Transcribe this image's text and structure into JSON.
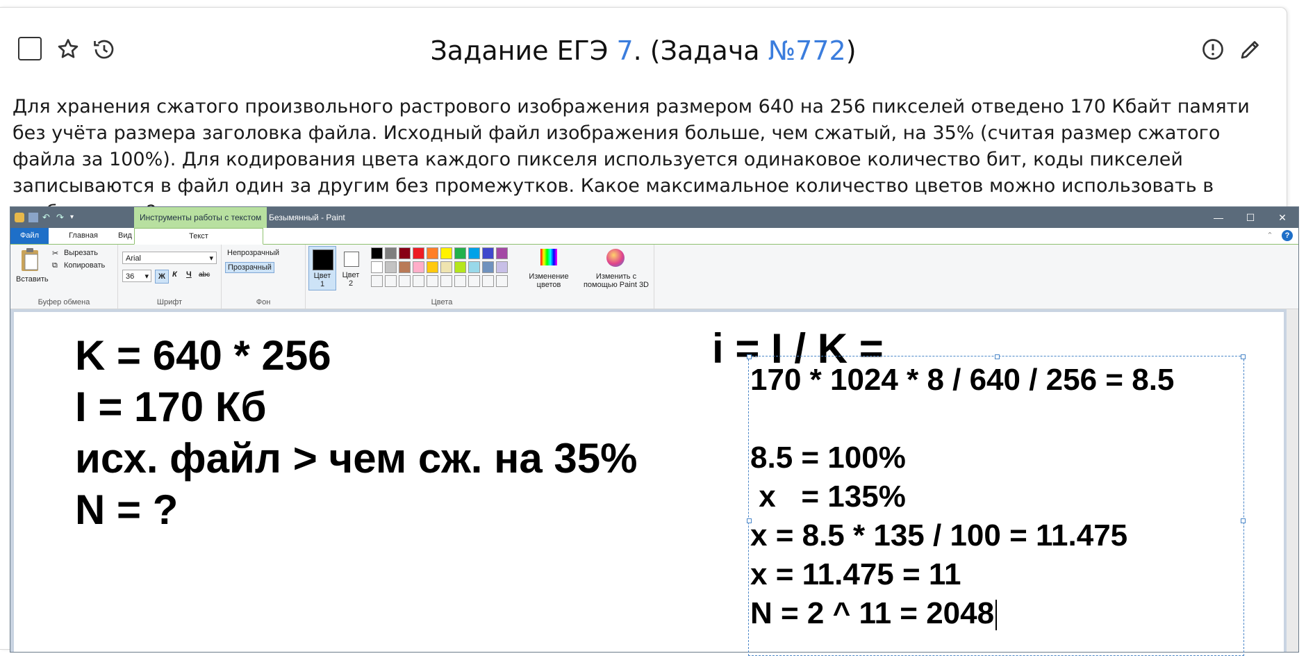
{
  "header": {
    "title_prefix": "Задание ЕГЭ ",
    "title_num": "7",
    "title_mid": ". (Задача ",
    "title_link": "№772",
    "title_suffix": ")"
  },
  "task_text": "Для хранения сжатого произвольного растрового изображения размером 640 на 256 пикселей отведено 170 Кбайт памяти без учёта размера заголовка файла. Исходный файл изображения больше, чем сжатый, на 35% (считая размер сжатого файла за 100%). Для кодирования цвета каждого пикселя используется одинаковое количество бит, коды пикселей записываются в файл один за другим без промежутков. Какое максимальное количество цветов можно использовать в изображении?",
  "paint": {
    "context_tab": "Инструменты работы с текстом",
    "window_title": "Безымянный - Paint",
    "tabs": [
      "Файл",
      "Главная",
      "Вид",
      "Текст"
    ],
    "clipboard": {
      "paste": "Вставить",
      "cut": "Вырезать",
      "copy": "Копировать",
      "label": "Буфер обмена"
    },
    "font": {
      "name": "Arial",
      "size": "36",
      "bold": "Ж",
      "italic": "К",
      "underline": "Ч",
      "strike": "abc",
      "label": "Шрифт"
    },
    "background": {
      "opaque": "Непрозрачный",
      "transparent": "Прозрачный",
      "label": "Фон"
    },
    "colors": {
      "color1": "Цвет\n1",
      "color2": "Цвет\n2",
      "edit": "Изменение\nцветов",
      "paint3d": "Изменить с\nпомощью Paint 3D",
      "label": "Цвета",
      "row1": [
        "#000000",
        "#7f7f7f",
        "#880015",
        "#ed1c24",
        "#ff7f27",
        "#fff200",
        "#22b14c",
        "#00a2e8",
        "#3f48cc",
        "#a349a4"
      ],
      "row2": [
        "#ffffff",
        "#c3c3c3",
        "#b97a57",
        "#ffaec9",
        "#ffc90e",
        "#efe4b0",
        "#b5e61d",
        "#99d9ea",
        "#7092be",
        "#c8bfe7"
      ]
    }
  },
  "canvas": {
    "left_lines": [
      "K = 640 * 256",
      "I = 170 Кб",
      "исх. файл > чем сж. на 35%",
      "N = ?"
    ],
    "formula_head": "i = I / K =",
    "right_lines": [
      "170 * 1024 * 8 / 640 / 256 = 8.5",
      "",
      "8.5 = 100%",
      " x   = 135%",
      "x = 8.5 * 135 / 100 = 11.475",
      "x = 11.475 = 11",
      "N = 2 ^ 11 = 2048"
    ]
  }
}
